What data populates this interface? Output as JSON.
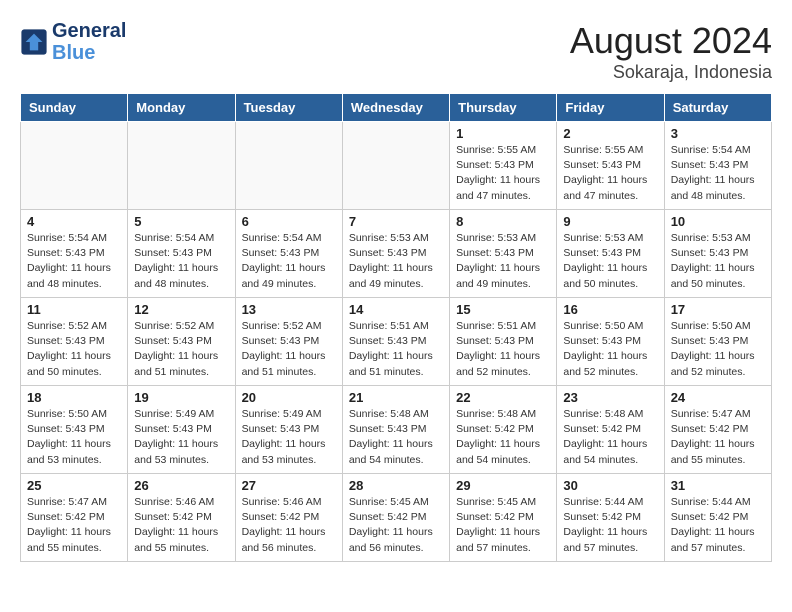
{
  "header": {
    "logo_line1": "General",
    "logo_line2": "Blue",
    "month_year": "August 2024",
    "location": "Sokaraja, Indonesia"
  },
  "weekdays": [
    "Sunday",
    "Monday",
    "Tuesday",
    "Wednesday",
    "Thursday",
    "Friday",
    "Saturday"
  ],
  "weeks": [
    [
      {
        "day": "",
        "empty": true
      },
      {
        "day": "",
        "empty": true
      },
      {
        "day": "",
        "empty": true
      },
      {
        "day": "",
        "empty": true
      },
      {
        "day": "1",
        "sunrise": "5:55 AM",
        "sunset": "5:43 PM",
        "daylight": "11 hours and 47 minutes."
      },
      {
        "day": "2",
        "sunrise": "5:55 AM",
        "sunset": "5:43 PM",
        "daylight": "11 hours and 47 minutes."
      },
      {
        "day": "3",
        "sunrise": "5:54 AM",
        "sunset": "5:43 PM",
        "daylight": "11 hours and 48 minutes."
      }
    ],
    [
      {
        "day": "4",
        "sunrise": "5:54 AM",
        "sunset": "5:43 PM",
        "daylight": "11 hours and 48 minutes."
      },
      {
        "day": "5",
        "sunrise": "5:54 AM",
        "sunset": "5:43 PM",
        "daylight": "11 hours and 48 minutes."
      },
      {
        "day": "6",
        "sunrise": "5:54 AM",
        "sunset": "5:43 PM",
        "daylight": "11 hours and 49 minutes."
      },
      {
        "day": "7",
        "sunrise": "5:53 AM",
        "sunset": "5:43 PM",
        "daylight": "11 hours and 49 minutes."
      },
      {
        "day": "8",
        "sunrise": "5:53 AM",
        "sunset": "5:43 PM",
        "daylight": "11 hours and 49 minutes."
      },
      {
        "day": "9",
        "sunrise": "5:53 AM",
        "sunset": "5:43 PM",
        "daylight": "11 hours and 50 minutes."
      },
      {
        "day": "10",
        "sunrise": "5:53 AM",
        "sunset": "5:43 PM",
        "daylight": "11 hours and 50 minutes."
      }
    ],
    [
      {
        "day": "11",
        "sunrise": "5:52 AM",
        "sunset": "5:43 PM",
        "daylight": "11 hours and 50 minutes."
      },
      {
        "day": "12",
        "sunrise": "5:52 AM",
        "sunset": "5:43 PM",
        "daylight": "11 hours and 51 minutes."
      },
      {
        "day": "13",
        "sunrise": "5:52 AM",
        "sunset": "5:43 PM",
        "daylight": "11 hours and 51 minutes."
      },
      {
        "day": "14",
        "sunrise": "5:51 AM",
        "sunset": "5:43 PM",
        "daylight": "11 hours and 51 minutes."
      },
      {
        "day": "15",
        "sunrise": "5:51 AM",
        "sunset": "5:43 PM",
        "daylight": "11 hours and 52 minutes."
      },
      {
        "day": "16",
        "sunrise": "5:50 AM",
        "sunset": "5:43 PM",
        "daylight": "11 hours and 52 minutes."
      },
      {
        "day": "17",
        "sunrise": "5:50 AM",
        "sunset": "5:43 PM",
        "daylight": "11 hours and 52 minutes."
      }
    ],
    [
      {
        "day": "18",
        "sunrise": "5:50 AM",
        "sunset": "5:43 PM",
        "daylight": "11 hours and 53 minutes."
      },
      {
        "day": "19",
        "sunrise": "5:49 AM",
        "sunset": "5:43 PM",
        "daylight": "11 hours and 53 minutes."
      },
      {
        "day": "20",
        "sunrise": "5:49 AM",
        "sunset": "5:43 PM",
        "daylight": "11 hours and 53 minutes."
      },
      {
        "day": "21",
        "sunrise": "5:48 AM",
        "sunset": "5:43 PM",
        "daylight": "11 hours and 54 minutes."
      },
      {
        "day": "22",
        "sunrise": "5:48 AM",
        "sunset": "5:42 PM",
        "daylight": "11 hours and 54 minutes."
      },
      {
        "day": "23",
        "sunrise": "5:48 AM",
        "sunset": "5:42 PM",
        "daylight": "11 hours and 54 minutes."
      },
      {
        "day": "24",
        "sunrise": "5:47 AM",
        "sunset": "5:42 PM",
        "daylight": "11 hours and 55 minutes."
      }
    ],
    [
      {
        "day": "25",
        "sunrise": "5:47 AM",
        "sunset": "5:42 PM",
        "daylight": "11 hours and 55 minutes."
      },
      {
        "day": "26",
        "sunrise": "5:46 AM",
        "sunset": "5:42 PM",
        "daylight": "11 hours and 55 minutes."
      },
      {
        "day": "27",
        "sunrise": "5:46 AM",
        "sunset": "5:42 PM",
        "daylight": "11 hours and 56 minutes."
      },
      {
        "day": "28",
        "sunrise": "5:45 AM",
        "sunset": "5:42 PM",
        "daylight": "11 hours and 56 minutes."
      },
      {
        "day": "29",
        "sunrise": "5:45 AM",
        "sunset": "5:42 PM",
        "daylight": "11 hours and 57 minutes."
      },
      {
        "day": "30",
        "sunrise": "5:44 AM",
        "sunset": "5:42 PM",
        "daylight": "11 hours and 57 minutes."
      },
      {
        "day": "31",
        "sunrise": "5:44 AM",
        "sunset": "5:42 PM",
        "daylight": "11 hours and 57 minutes."
      }
    ]
  ]
}
